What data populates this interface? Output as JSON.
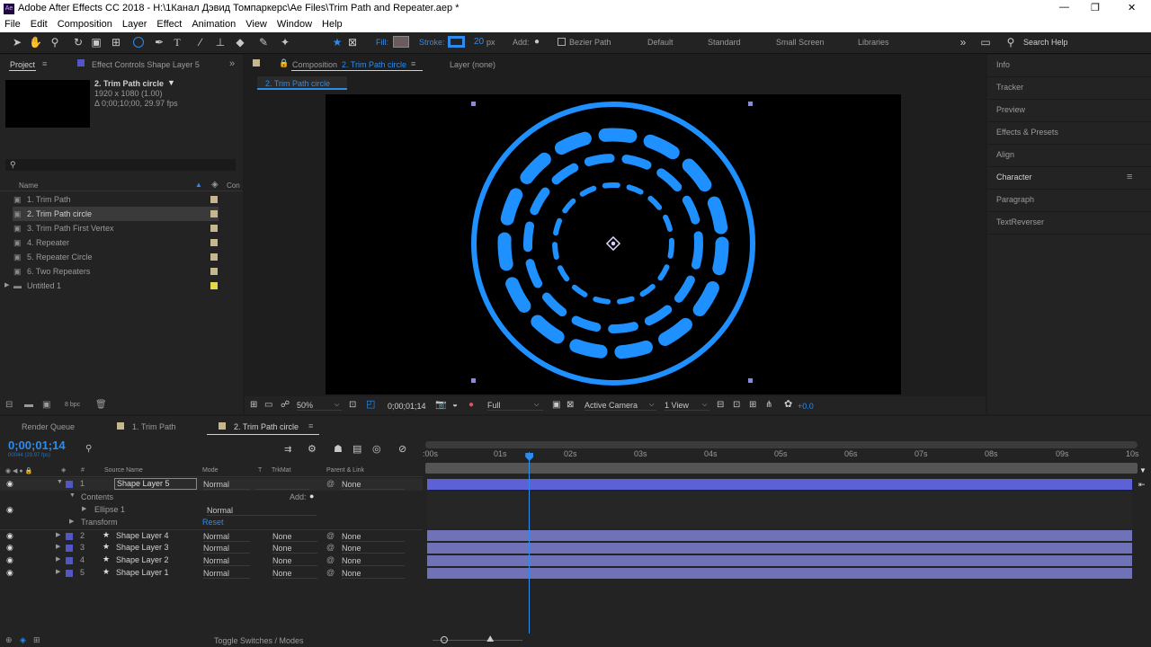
{
  "window": {
    "title": "Adobe After Effects CC 2018 - H:\\1Канал Дэвид Томпаркерс\\Ae Files\\Trim Path and Repeater.aep *",
    "app_icon": "Ae",
    "min": "—",
    "max": "❐",
    "close": "✕"
  },
  "menu": [
    "File",
    "Edit",
    "Composition",
    "Layer",
    "Effect",
    "Animation",
    "View",
    "Window",
    "Help"
  ],
  "toolbar": {
    "fill": "Fill:",
    "stroke": "Stroke:",
    "stroke_width": "20",
    "px": "px",
    "add": "Add:",
    "bezier": "Bezier Path",
    "workspaces": [
      "Default",
      "Standard",
      "Small Screen",
      "Libraries"
    ],
    "search": "Search Help"
  },
  "project": {
    "tab": "Project",
    "effect_controls": "Effect Controls  Shape Layer 5",
    "item_name": "2. Trim Path circle",
    "item_size": "1920 x 1080 (1.00)",
    "item_duration": "Δ 0;00;10;00, 29.97 fps",
    "col_name": "Name",
    "col_extra": "Con",
    "items": [
      "1. Trim Path",
      "2. Trim Path circle",
      "3. Trim Path First Vertex",
      "4. Repeater",
      "5. Repeater Circle",
      "6. Two Repeaters",
      "Untitled 1"
    ],
    "bpc": "8 bpc"
  },
  "comp": {
    "tab_prefix": "Composition",
    "tab_name": "2. Trim Path circle",
    "layer_tab": "Layer  (none)",
    "breadcrumb": "2. Trim Path circle",
    "zoom": "50%",
    "timecode": "0;00;01;14",
    "resolution": "Full",
    "camera": "Active Camera",
    "view": "1 View",
    "exposure": "+0.0"
  },
  "right_panel": [
    "Info",
    "Tracker",
    "Preview",
    "Effects & Presets",
    "Align",
    "Character",
    "Paragraph",
    "TextReverser"
  ],
  "timeline": {
    "tabs": [
      "Render Queue",
      "1. Trim Path",
      "2. Trim Path circle"
    ],
    "timecode": "0;00;01;14",
    "fps_sub": "00044 (29.97 fps)",
    "cols": {
      "num": "#",
      "source": "Source Name",
      "mode": "Mode",
      "t": "T",
      "trkmat": "TrkMat",
      "parent": "Parent & Link"
    },
    "ticks": [
      ":00s",
      "01s",
      "02s",
      "03s",
      "04s",
      "05s",
      "06s",
      "07s",
      "08s",
      "09s",
      "10s"
    ],
    "time_seconds": 1.47,
    "duration_seconds": 10,
    "layers": [
      {
        "num": "1",
        "name": "Shape Layer 5",
        "mode": "Normal",
        "trkmat": "",
        "parent": "None"
      },
      {
        "num": "2",
        "name": "Shape Layer 4",
        "mode": "Normal",
        "trkmat": "None",
        "parent": "None"
      },
      {
        "num": "3",
        "name": "Shape Layer 3",
        "mode": "Normal",
        "trkmat": "None",
        "parent": "None"
      },
      {
        "num": "4",
        "name": "Shape Layer 2",
        "mode": "Normal",
        "trkmat": "None",
        "parent": "None"
      },
      {
        "num": "5",
        "name": "Shape Layer 1",
        "mode": "Normal",
        "trkmat": "None",
        "parent": "None"
      }
    ],
    "contents": "Contents",
    "add": "Add:",
    "ellipse": "Ellipse 1",
    "ellipse_mode": "Normal",
    "transform": "Transform",
    "reset": "Reset",
    "toggle": "Toggle Switches / Modes"
  },
  "colors": {
    "accent": "#2d8ceb",
    "shape": "#1e90ff",
    "layer_bar": "#6f72b6",
    "selected_bar": "#5c62d6"
  }
}
